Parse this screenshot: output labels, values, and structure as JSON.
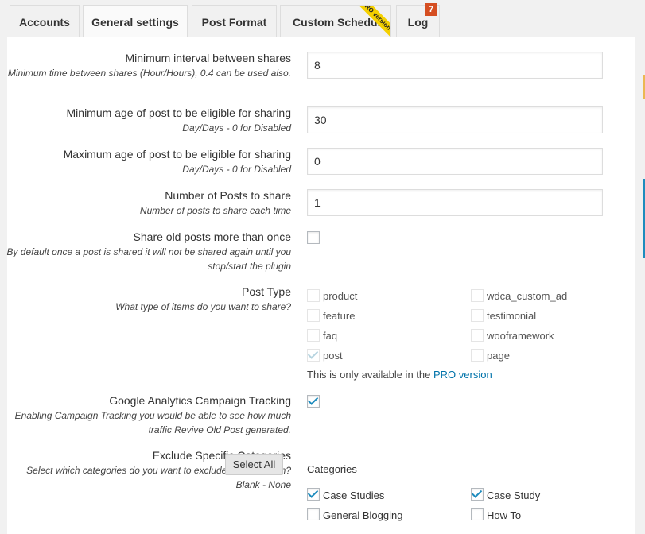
{
  "tabs": [
    {
      "label": "Accounts"
    },
    {
      "label": "General settings"
    },
    {
      "label": "Post Format"
    },
    {
      "label": "Custom Schedule",
      "ribbon": "PRO version"
    },
    {
      "label": "Log",
      "badge": "7"
    }
  ],
  "fields": {
    "min_interval": {
      "label": "Minimum interval between shares",
      "desc": "Minimum time between shares (Hour/Hours), 0.4 can be used also.",
      "value": "8"
    },
    "min_age": {
      "label": "Minimum age of post to be eligible for sharing",
      "desc": "Day/Days - 0 for Disabled",
      "value": "30"
    },
    "max_age": {
      "label": "Maximum age of post to be eligible for sharing",
      "desc": "Day/Days - 0 for Disabled",
      "value": "0"
    },
    "num_posts": {
      "label": "Number of Posts to share",
      "desc": "Number of posts to share each time",
      "value": "1"
    },
    "share_more": {
      "label": "Share old posts more than once",
      "desc": "By default once a post is shared it will not be shared again until you stop/start the plugin",
      "checked": false
    },
    "post_type": {
      "label": "Post Type",
      "desc": "What type of items do you want to share?",
      "options": [
        {
          "label": "product",
          "checked": false
        },
        {
          "label": "wdca_custom_ad",
          "checked": false
        },
        {
          "label": "feature",
          "checked": false
        },
        {
          "label": "testimonial",
          "checked": false
        },
        {
          "label": "faq",
          "checked": false
        },
        {
          "label": "wooframework",
          "checked": false
        },
        {
          "label": "post",
          "checked": true
        },
        {
          "label": "page",
          "checked": false
        }
      ],
      "note_prefix": "This is only available in the ",
      "note_link": "PRO version"
    },
    "ga": {
      "label": "Google Analytics Campaign Tracking",
      "desc": "Enabling Campaign Tracking you would be able to see how much traffic Revive Old Post generated.",
      "checked": true
    },
    "exclude": {
      "label": "Exclude Specific Categories",
      "desc": "Select which categories do you want to exclude to share from?",
      "desc2": "Blank - None",
      "button": "Select All",
      "categories_title": "Categories",
      "categories": [
        {
          "label": "Case Studies",
          "checked": true
        },
        {
          "label": "Case Study",
          "checked": true
        },
        {
          "label": "General Blogging",
          "checked": false
        },
        {
          "label": "How To",
          "checked": false
        }
      ]
    }
  },
  "colors": {
    "accent": "#0073aa",
    "check": "#1e8cbe",
    "ribbon": "#f4d000",
    "badge": "#d54e21"
  }
}
